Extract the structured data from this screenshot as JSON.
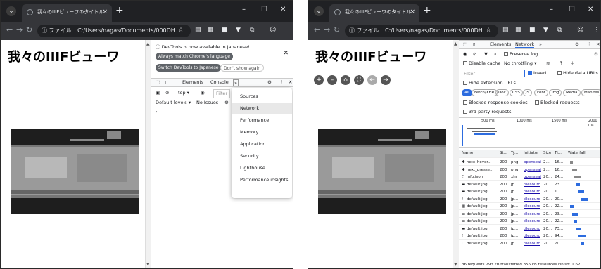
{
  "browser": {
    "tab_title": "我々のIIIFビューワのタイトル",
    "address_scheme": "ファイル",
    "address_path": "C:/Users/nagas/Documents/000DH..."
  },
  "page": {
    "title": "我々のIIIFビューワ"
  },
  "devtools_left": {
    "info_text": "DevTools is now available in Japanese!",
    "always_match_button": "Always match Chrome's language",
    "switch_button": "Switch DevTools to Japanese",
    "dont_show_button": "Don't show again",
    "tab_elements": "Elements",
    "tab_console": "Console",
    "top_select": "top ▾",
    "filter_placeholder": "Filter",
    "default_levels": "Default levels ▾",
    "no_issues": "No Issues",
    "prompt": "›",
    "menu_items": [
      "Sources",
      "Network",
      "Performance",
      "Memory",
      "Application",
      "Security",
      "Lighthouse",
      "Performance insights"
    ]
  },
  "devtools_right": {
    "tab_elements": "Elements",
    "tab_network": "Network",
    "preserve_log": "Preserve log",
    "disable_cache": "Disable cache",
    "throttling": "No throttling",
    "filter_placeholder": "Filter",
    "invert": "Invert",
    "hide_data_urls": "Hide data URLs",
    "hide_extension_urls": "Hide extension URLs",
    "type_chips": [
      "All",
      "Fetch/XHR",
      "Doc",
      "CSS",
      "JS",
      "Font",
      "Img",
      "Media",
      "Manifes"
    ],
    "blocked_cookies": "Blocked response cookies",
    "blocked_requests": "Blocked requests",
    "third_party": "3rd-party requests",
    "timeline_ticks": [
      "500 ms",
      "1000 ms",
      "1500 ms",
      "2000 ms"
    ],
    "columns": [
      "Name",
      "St...",
      "Ty...",
      "Initiator",
      "Size",
      "Ti...",
      "Waterfall"
    ],
    "requests": [
      {
        "name": "next_hover...",
        "status": "200",
        "type": "png",
        "initiator": "openseai",
        "size": "2...",
        "time": "16..."
      },
      {
        "name": "next_presse...",
        "status": "200",
        "type": "png",
        "initiator": "openseai",
        "size": "2...",
        "time": "16..."
      },
      {
        "name": "info.json",
        "status": "200",
        "type": "xhr",
        "initiator": "openseai",
        "size": "20...",
        "time": "24..."
      },
      {
        "name": "default.jpg",
        "status": "200",
        "type": "jp...",
        "initiator": "tilesourc",
        "size": "20...",
        "time": "23..."
      },
      {
        "name": "default.jpg",
        "status": "200",
        "type": "jp...",
        "initiator": "tilesourc",
        "size": "20...",
        "time": "1..."
      },
      {
        "name": "default.jpg",
        "status": "200",
        "type": "jp...",
        "initiator": "tilesourc",
        "size": "20...",
        "time": "20..."
      },
      {
        "name": "default.jpg",
        "status": "200",
        "type": "jp...",
        "initiator": "tilesourc",
        "size": "20...",
        "time": "22..."
      },
      {
        "name": "default.jpg",
        "status": "200",
        "type": "jp...",
        "initiator": "tilesourc",
        "size": "20...",
        "time": "23..."
      },
      {
        "name": "default.jpg",
        "status": "200",
        "type": "jp...",
        "initiator": "tilesourc",
        "size": "20...",
        "time": "22..."
      },
      {
        "name": "default.jpg",
        "status": "200",
        "type": "jp...",
        "initiator": "tilesourc",
        "size": "20...",
        "time": "73..."
      },
      {
        "name": "default.jpg",
        "status": "200",
        "type": "jp...",
        "initiator": "tilesourc",
        "size": "20...",
        "time": "94..."
      },
      {
        "name": "default.jpg",
        "status": "200",
        "type": "jp...",
        "initiator": "tilesourc",
        "size": "20...",
        "time": "70..."
      }
    ],
    "status_bar": "36 requests   293 kB transferred   356 kB resources   Finish: 1.62"
  },
  "colors": {
    "accent": "#2d6cdf",
    "dark_pill": "#5f6368"
  }
}
